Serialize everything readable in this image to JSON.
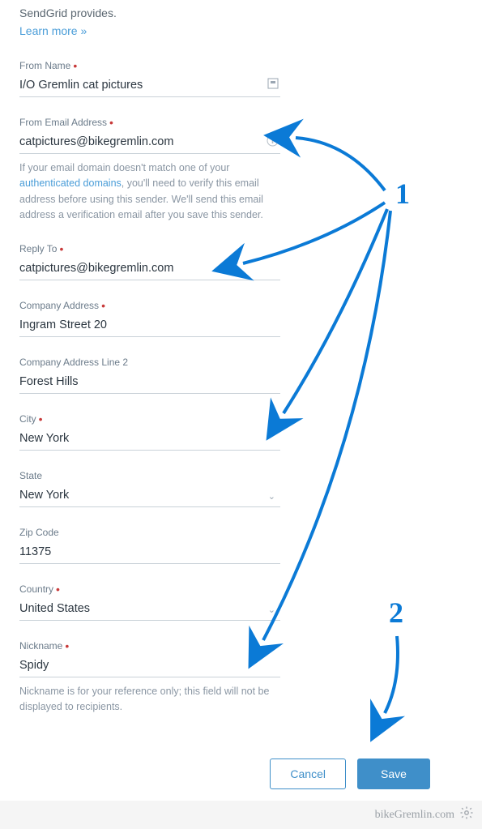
{
  "intro": {
    "text_fragment": "SendGrid provides.",
    "learn_more": "Learn more »"
  },
  "fields": {
    "from_name": {
      "label": "From Name",
      "value": "I/O Gremlin cat pictures"
    },
    "from_email": {
      "label": "From Email Address",
      "value": "catpictures@bikegremlin.com",
      "help_pre": "If your email domain doesn't match one of your ",
      "help_link": "authenticated domains",
      "help_post": ", you'll need to verify this email address before using this sender. We'll send this email address a verification email after you save this sender."
    },
    "reply_to": {
      "label": "Reply To",
      "value": "catpictures@bikegremlin.com"
    },
    "company_address": {
      "label": "Company Address",
      "value": "Ingram Street 20"
    },
    "company_address2": {
      "label": "Company Address Line 2",
      "value": "Forest Hills"
    },
    "city": {
      "label": "City",
      "value": "New York"
    },
    "state": {
      "label": "State",
      "value": "New York"
    },
    "zip": {
      "label": "Zip Code",
      "value": "11375"
    },
    "country": {
      "label": "Country",
      "value": "United States"
    },
    "nickname": {
      "label": "Nickname",
      "value": "Spidy",
      "help": "Nickname is for your reference only; this field will not be displayed to recipients."
    }
  },
  "buttons": {
    "cancel": "Cancel",
    "save": "Save"
  },
  "annotations": {
    "one": "1",
    "two": "2"
  },
  "footer": {
    "text": "bikeGremlin.com"
  }
}
